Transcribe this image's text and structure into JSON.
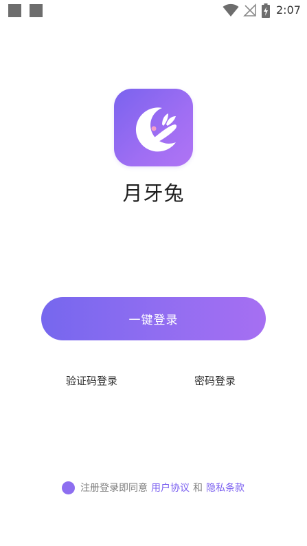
{
  "status_bar": {
    "time": "2:07",
    "icons": [
      "notification-square-icon",
      "notification-square-icon",
      "wifi-icon",
      "no-signal-icon",
      "battery-charging-icon"
    ]
  },
  "app": {
    "name": "月牙兔",
    "icon": "moon-rabbit-logo-icon"
  },
  "login": {
    "one_click_label": "一键登录",
    "sms_login_label": "验证码登录",
    "password_login_label": "密码登录"
  },
  "agreement": {
    "prefix": "注册登录即同意",
    "user_agreement": "用户协议",
    "conjunction": "和",
    "privacy_policy": "隐私条款"
  },
  "colors": {
    "accent": "#8d6ef0",
    "gradient_start": "#7667ee",
    "gradient_end": "#a66ff2",
    "link": "#7a5ff0"
  }
}
